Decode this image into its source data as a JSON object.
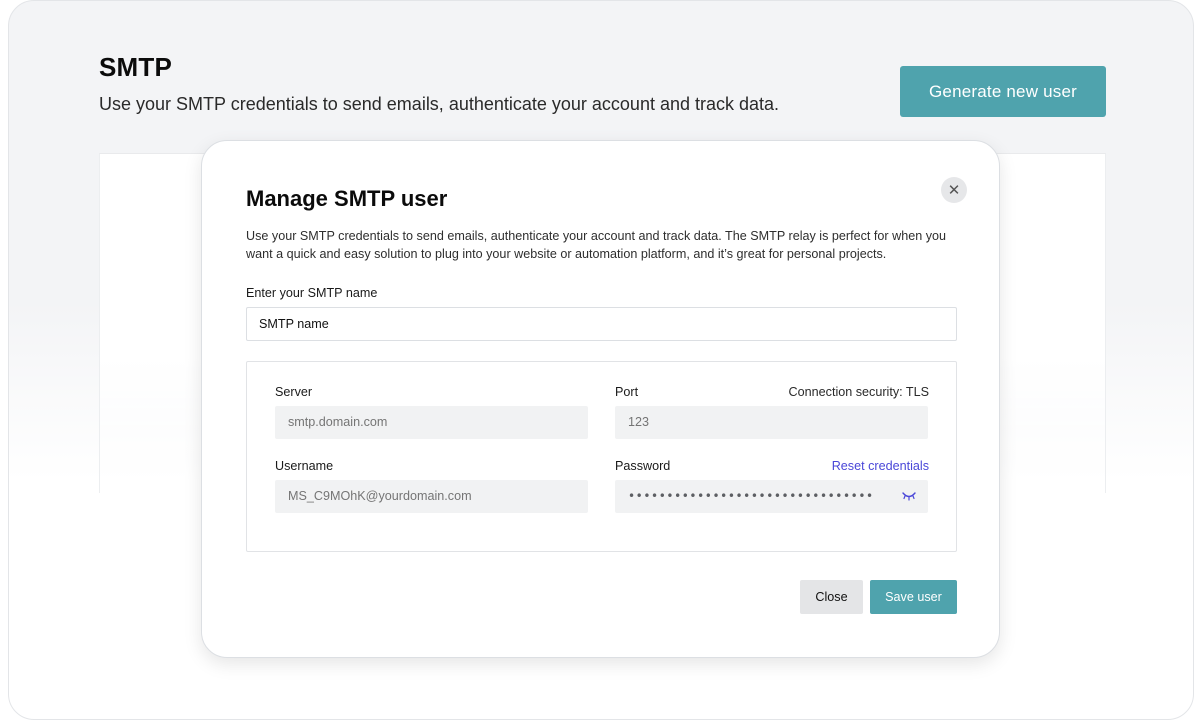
{
  "page": {
    "title": "SMTP",
    "subtitle": "Use your SMTP credentials to send emails, authenticate your account and track data.",
    "generate_button": "Generate new user"
  },
  "modal": {
    "close_icon": "close-icon",
    "title": "Manage SMTP user",
    "description": "Use your SMTP credentials to send emails, authenticate your account and track data. The SMTP relay is perfect for when you want a quick and easy solution to plug into your website or automation platform, and it’s great for personal projects.",
    "name_label": "Enter your SMTP name",
    "name_value": "SMTP name",
    "credentials": {
      "server_label": "Server",
      "server_placeholder": "smtp.domain.com",
      "port_label": "Port",
      "connection_security": "Connection security: TLS",
      "port_placeholder": "123",
      "username_label": "Username",
      "username_placeholder": "MS_C9MOhK@yourdomain.com",
      "password_label": "Password",
      "reset_link": "Reset credentials",
      "password_masked": "••••••••••••••••••••••••••••••••",
      "eye_icon": "eye-closed-icon"
    },
    "close_button": "Close",
    "save_button": "Save user"
  },
  "colors": {
    "accent": "#4fa3ad",
    "link": "#4a47d8",
    "input_bg": "#f1f2f3"
  }
}
